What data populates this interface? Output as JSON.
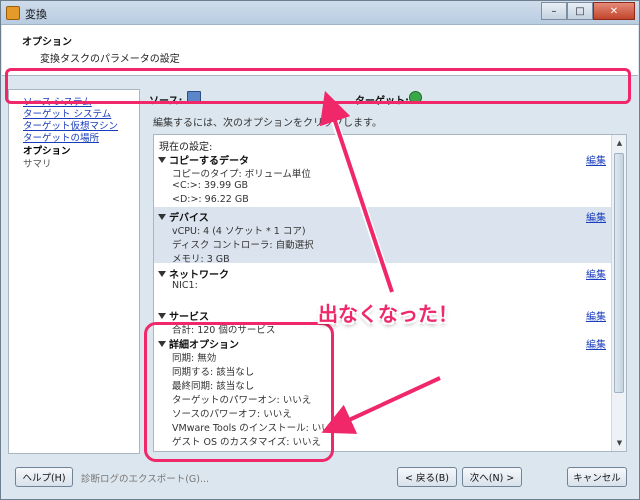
{
  "window": {
    "title": "変換",
    "minimize_label": "–",
    "maximize_label": "□",
    "close_label": "✕"
  },
  "header": {
    "title": "オプション",
    "subtitle": "変換タスクのパラメータの設定"
  },
  "nav": {
    "items": [
      {
        "label": "ソース システム"
      },
      {
        "label": "ターゲット システム"
      },
      {
        "label": "ターゲット仮想マシン"
      },
      {
        "label": "ターゲットの場所"
      },
      {
        "label": "オプション"
      },
      {
        "label": "サマリ"
      }
    ]
  },
  "source_label": "ソース:",
  "target_label": "ターゲット:",
  "instruction": "編集するには、次のオプションをクリックします。",
  "settings": {
    "current_label": "現在の設定:",
    "edit_label": "編集",
    "sections": [
      {
        "title": "コピーするデータ",
        "rows": [
          "コピーのタイプ: ボリューム単位",
          "<C:>: 39.99 GB",
          "<D:>: 96.22 GB"
        ]
      },
      {
        "title": "デバイス",
        "rows": [
          "vCPU: 4 (4 ソケット * 1 コア)",
          "ディスク コントローラ: 自動選択",
          "メモリ: 3 GB"
        ]
      },
      {
        "title": "ネットワーク",
        "rows": [
          "NIC1: "
        ]
      },
      {
        "title": "サービス",
        "rows": [
          "合計: 120 個のサービス"
        ]
      },
      {
        "title": "詳細オプション",
        "rows": [
          "同期: 無効",
          "同期する: 該当なし",
          "最終同期: 該当なし",
          "ターゲットのパワーオン: いいえ",
          "ソースのパワーオフ: いいえ",
          "VMware Tools のインストール: いいえ",
          "ゲスト OS のカスタマイズ: いいえ"
        ]
      }
    ]
  },
  "buttons": {
    "help": "ヘルプ(H)",
    "export": "診断ログのエクスポート(G)...",
    "back": "< 戻る(B)",
    "next": "次へ(N) >",
    "cancel": "キャンセル"
  },
  "annotation": {
    "callout": "出なくなった！",
    "color": "#f02769"
  }
}
